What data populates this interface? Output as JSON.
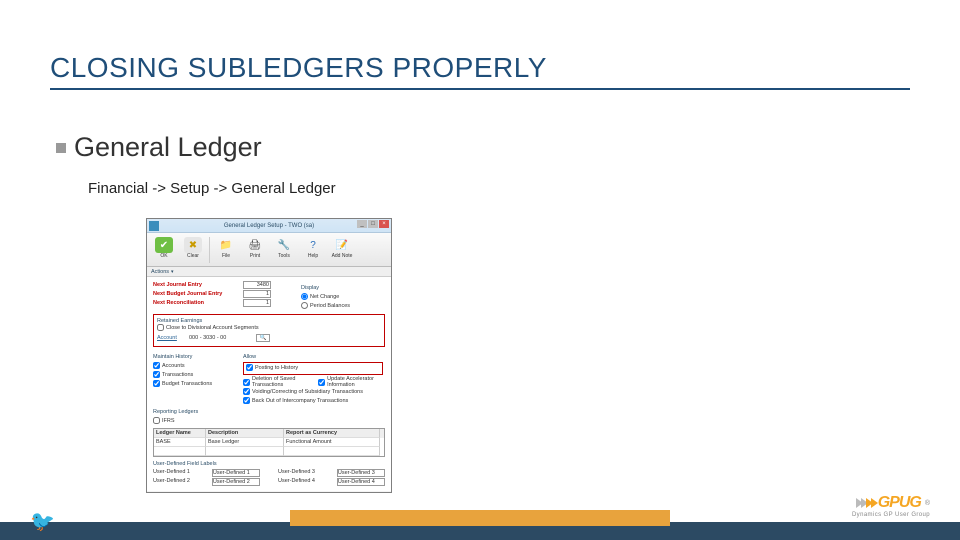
{
  "title": "CLOSING SUBLEDGERS PROPERLY",
  "subheader": "General Ledger",
  "breadcrumb": "Financial -> Setup -> General Ledger",
  "dialog": {
    "title": "General Ledger Setup - TWO (sa)",
    "ribbon": {
      "ok": "OK",
      "clear": "Clear",
      "file": "File",
      "print": "Print",
      "tools": "Tools",
      "help": "Help",
      "add_note": "Add Note"
    },
    "actions": "Actions",
    "fields": {
      "next_journal": {
        "label": "Next Journal Entry",
        "value": "3480"
      },
      "next_budget": {
        "label": "Next Budget Journal Entry",
        "value": "1"
      },
      "next_recon": {
        "label": "Next Reconciliation",
        "value": "1"
      }
    },
    "display": {
      "label": "Display",
      "net": "Net Change",
      "period": "Period Balances"
    },
    "retained": {
      "label": "Retained Earnings",
      "close": "Close to Divisional Account Segments",
      "account": "Account",
      "account_val": "000 - 3030 - 00"
    },
    "maintain": {
      "label": "Maintain History",
      "accounts": "Accounts",
      "transactions": "Transactions",
      "budget": "Budget Transactions"
    },
    "allow": {
      "label": "Allow",
      "posting_hist": "Posting to History",
      "delete_saved": "Deletion of Saved Transactions",
      "voiding_saved": "Voiding/Correcting of Subsidiary Transactions",
      "back_out": "Back Out of Intercompany Transactions",
      "update_rate": "Update Accelerator Information"
    },
    "reporting": {
      "label": "Reporting Ledgers",
      "ifrs": "IFRS"
    },
    "ledger": {
      "c1": "Ledger Name",
      "c2": "Description",
      "c3": "Report as Currency",
      "r1c1": "BASE",
      "r1c2": "Base Ledger",
      "r1c3": "Functional Amount"
    },
    "userdef": {
      "label": "User-Defined Field Labels",
      "u1": "User-Defined 1",
      "u1v": "User-Defined 1",
      "u2": "User-Defined 2",
      "u2v": "User-Defined 2",
      "u3": "User-Defined 3",
      "u3v": "User-Defined 3",
      "u4": "User-Defined 4",
      "u4v": "User-Defined 4"
    }
  },
  "brand": {
    "name": "GPUG",
    "tag": "Dynamics GP User Group"
  }
}
